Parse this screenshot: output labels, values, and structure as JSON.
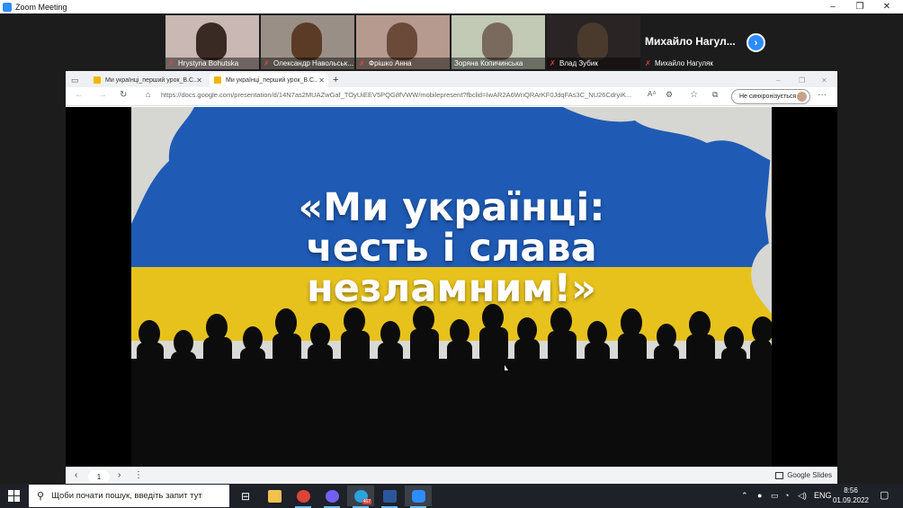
{
  "zoom": {
    "title": "Zoom Meeting",
    "minimize": "–",
    "maximize": "❐",
    "close": "✕",
    "participants": [
      {
        "name": "Hrystyna Bohutska",
        "muted": true,
        "bg": "#c9b8b4",
        "head": "#3a2a24"
      },
      {
        "name": "Олександр Навольськ...",
        "muted": true,
        "bg": "#9a8f86",
        "head": "#5b3b26"
      },
      {
        "name": "Фрішко Анна",
        "muted": true,
        "bg": "#b79a8f",
        "head": "#6b4a3a"
      },
      {
        "name": "Зоряна Копичинська",
        "muted": false,
        "bg": "#c2c9b4",
        "head": "#7a6a5e"
      },
      {
        "name": "Влад Зубик",
        "muted": true,
        "bg": "#2a2424",
        "head": "#4a3a2e"
      }
    ],
    "featured": {
      "title": "Михайло  Нагул...",
      "name": "Михайло Нагуляк",
      "muted": true
    },
    "next_icon": "›"
  },
  "browser": {
    "tabs": [
      {
        "label": "Ми українці_перший урок_В.С..",
        "close": "✕"
      },
      {
        "label": "Ми українці_перший урок_В.С..",
        "close": "✕"
      }
    ],
    "new_tab": "+",
    "window_minimize": "–",
    "window_restore": "❐",
    "window_close": "✕",
    "url": "https://docs.google.com/presentation/d/14N7as2MUAZwGaf_TOyUiEEV5PQG8fVWW/mobilepresent?fbclid=IwAR2A6WnQRArKF0JdqFAs3C_NU26CdryiK...",
    "sync_label": "Не синхронізується",
    "more": "···"
  },
  "slide": {
    "line1": "«Ми українці:",
    "line2": "честь і слава",
    "line3": "незламним!»",
    "colors": {
      "blue": "#1f5bb5",
      "yellow": "#e7c21d",
      "white": "#d9d9d6"
    }
  },
  "slides_bar": {
    "prev": "‹",
    "page": "1",
    "next": "›",
    "menu": "⋮",
    "brand": "Google Slides"
  },
  "taskbar": {
    "search_placeholder": "Щоби почати пошук, введіть запит тут",
    "telegram_badge": "467",
    "lang": "ENG",
    "time": "8:56",
    "date": "01.09.2022"
  }
}
